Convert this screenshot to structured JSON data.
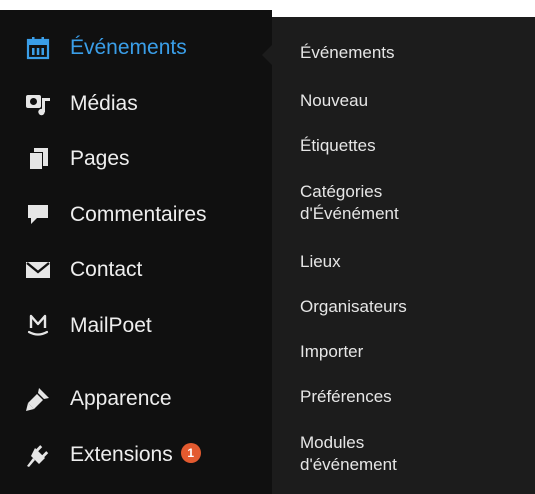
{
  "sidebar": {
    "items": [
      {
        "label": "Événements",
        "icon": "calendar-icon"
      },
      {
        "label": "Médias",
        "icon": "media-icon"
      },
      {
        "label": "Pages",
        "icon": "pages-icon"
      },
      {
        "label": "Commentaires",
        "icon": "comment-icon"
      },
      {
        "label": "Contact",
        "icon": "mail-icon"
      },
      {
        "label": "MailPoet",
        "icon": "mailpoet-icon"
      },
      {
        "label": "Apparence",
        "icon": "appearance-icon"
      },
      {
        "label": "Extensions",
        "icon": "plugin-icon",
        "badge": "1"
      }
    ]
  },
  "submenu": {
    "items": [
      {
        "label": "Événements"
      },
      {
        "label": "Nouveau"
      },
      {
        "label": "Étiquettes"
      },
      {
        "label": "Catégories\nd'Événément"
      },
      {
        "label": "Lieux"
      },
      {
        "label": "Organisateurs"
      },
      {
        "label": "Importer"
      },
      {
        "label": "Préférences"
      },
      {
        "label": "Modules\nd'événement"
      }
    ]
  },
  "colors": {
    "sidebar_bg": "#101010",
    "flyout_bg": "#1c1c1c",
    "active_text": "#3a9ee8",
    "badge_bg": "#e35a2f"
  }
}
